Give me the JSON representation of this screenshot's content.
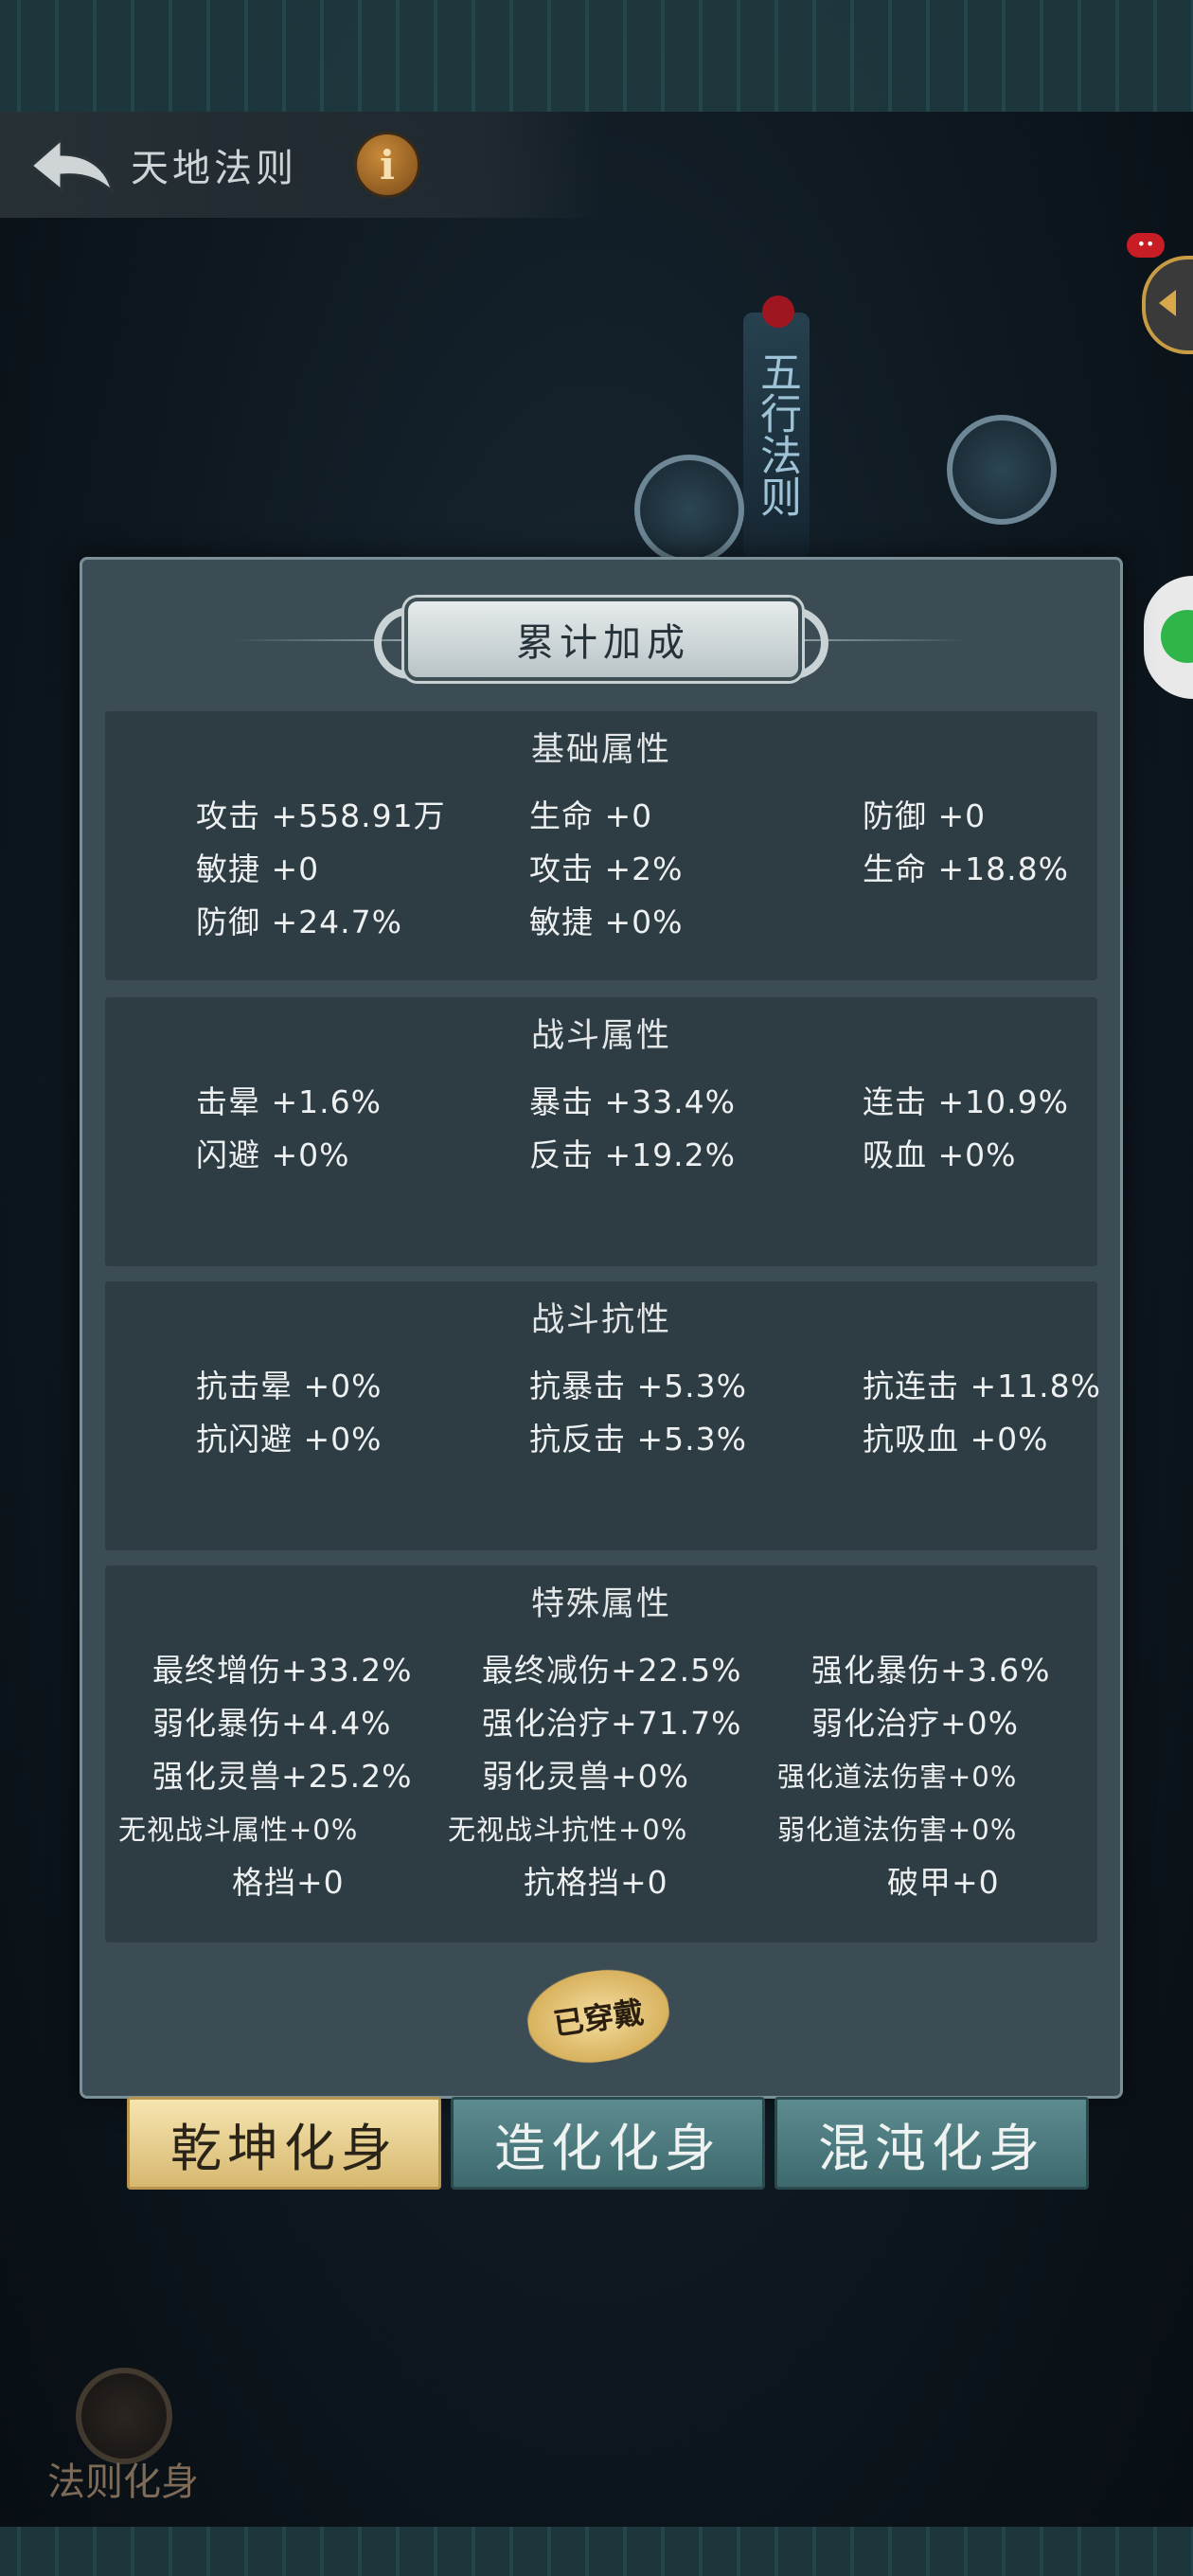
{
  "header": {
    "title": "天地法则",
    "info_label": "i"
  },
  "background": {
    "wuxing_label": "五行法则",
    "notification_badge": "••"
  },
  "panel": {
    "title": "累计加成",
    "sections": [
      {
        "title": "基础属性",
        "rows": [
          [
            "攻击 +558.91万",
            "生命 +0",
            "防御 +0"
          ],
          [
            "敏捷 +0",
            "攻击 +2%",
            "生命 +18.8%"
          ],
          [
            "防御 +24.7%",
            "敏捷 +0%",
            ""
          ]
        ]
      },
      {
        "title": "战斗属性",
        "rows": [
          [
            "击晕 +1.6%",
            "暴击 +33.4%",
            "连击 +10.9%"
          ],
          [
            "闪避 +0%",
            "反击 +19.2%",
            "吸血 +0%"
          ]
        ]
      },
      {
        "title": "战斗抗性",
        "rows": [
          [
            "抗击晕 +0%",
            "抗暴击 +5.3%",
            "抗连击 +11.8%"
          ],
          [
            "抗闪避 +0%",
            "抗反击 +5.3%",
            "抗吸血 +0%"
          ]
        ]
      },
      {
        "title": "特殊属性",
        "rows": [
          [
            "最终增伤+33.2%",
            "最终减伤+22.5%",
            "强化暴伤+3.6%"
          ],
          [
            "弱化暴伤+4.4%",
            "强化治疗+71.7%",
            "弱化治疗+0%"
          ],
          [
            "强化灵兽+25.2%",
            "弱化灵兽+0%",
            "强化道法伤害+0%"
          ],
          [
            "无视战斗属性+0%",
            "无视战斗抗性+0%",
            "弱化道法伤害+0%"
          ],
          [
            "格挡+0",
            "抗格挡+0",
            "破甲+0"
          ]
        ]
      }
    ],
    "worn_badge": "已穿戴"
  },
  "tabs": [
    {
      "label": "乾坤化身",
      "active": true
    },
    {
      "label": "造化化身",
      "active": false
    },
    {
      "label": "混沌化身",
      "active": false
    }
  ],
  "bottom_nav": {
    "label": "法则化身"
  },
  "colors": {
    "panel_bg": "#3b4c54",
    "section_bg": "#2e3c43",
    "tab_active": "#f0dda4",
    "tab_inactive": "#4f7c80"
  }
}
